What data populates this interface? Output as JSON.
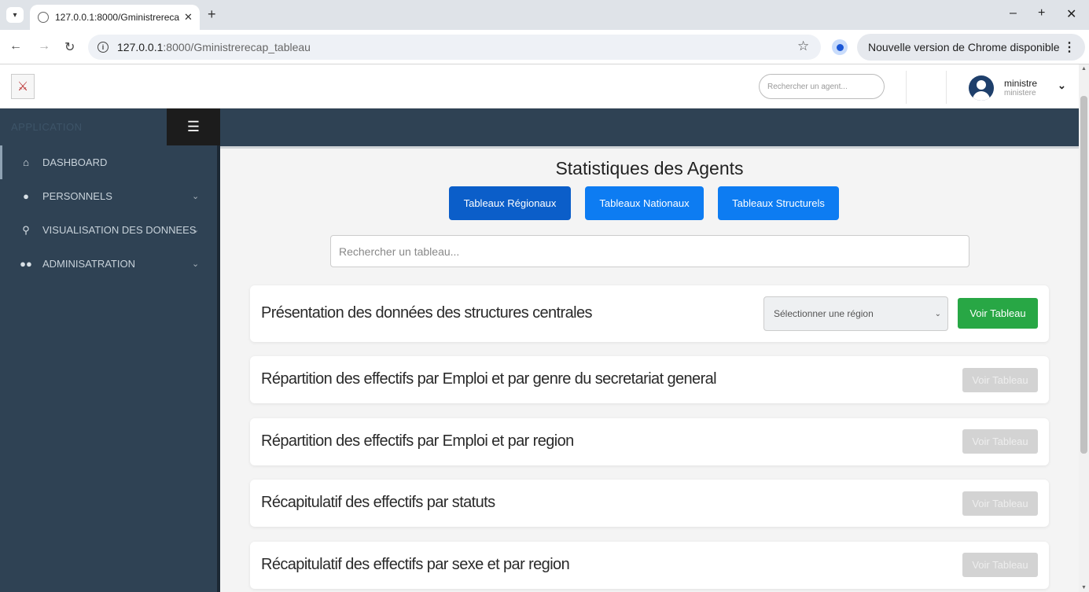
{
  "browser": {
    "tab_title": "127.0.0.1:8000/Gministrerecap_tableau",
    "url_host": "127.0.0.1",
    "url_rest": ":8000/Gministrerecap_tableau",
    "update_chip": "Nouvelle version de Chrome disponible"
  },
  "header": {
    "agent_search_placeholder": "Rechercher un agent...",
    "user_name": "ministre",
    "user_role": "ministere"
  },
  "sidebar": {
    "app_label": "APPLICATION",
    "items": [
      {
        "label": "DASHBOARD",
        "icon": "home-icon"
      },
      {
        "label": "PERSONNELS",
        "icon": "user-icon"
      },
      {
        "label": "VISUALISATION DES DONNEES",
        "icon": "map-marker-icon"
      },
      {
        "label": "ADMINISATRATION",
        "icon": "users-icon"
      }
    ]
  },
  "main": {
    "title": "Statistiques des Agents",
    "categories": [
      "Tableaux Régionaux",
      "Tableaux Nationaux",
      "Tableaux Structurels"
    ],
    "table_search_placeholder": "Rechercher un tableau...",
    "region_select_value": "Sélectionner une région",
    "view_label": "Voir Tableau",
    "cards": [
      "Présentation des données des structures centrales",
      "Répartition des effectifs par Emploi et par genre du secretariat general",
      "Répartition des effectifs par Emploi et par region",
      "Récapitulatif des effectifs par statuts",
      "Récapitulatif des effectifs par sexe et par region"
    ]
  },
  "colors": {
    "sidebar": "#2f4254",
    "primary": "#0d7cf2",
    "primary_active": "#0b5ec9",
    "success": "#28a745",
    "disabled": "#d3d3d3"
  }
}
